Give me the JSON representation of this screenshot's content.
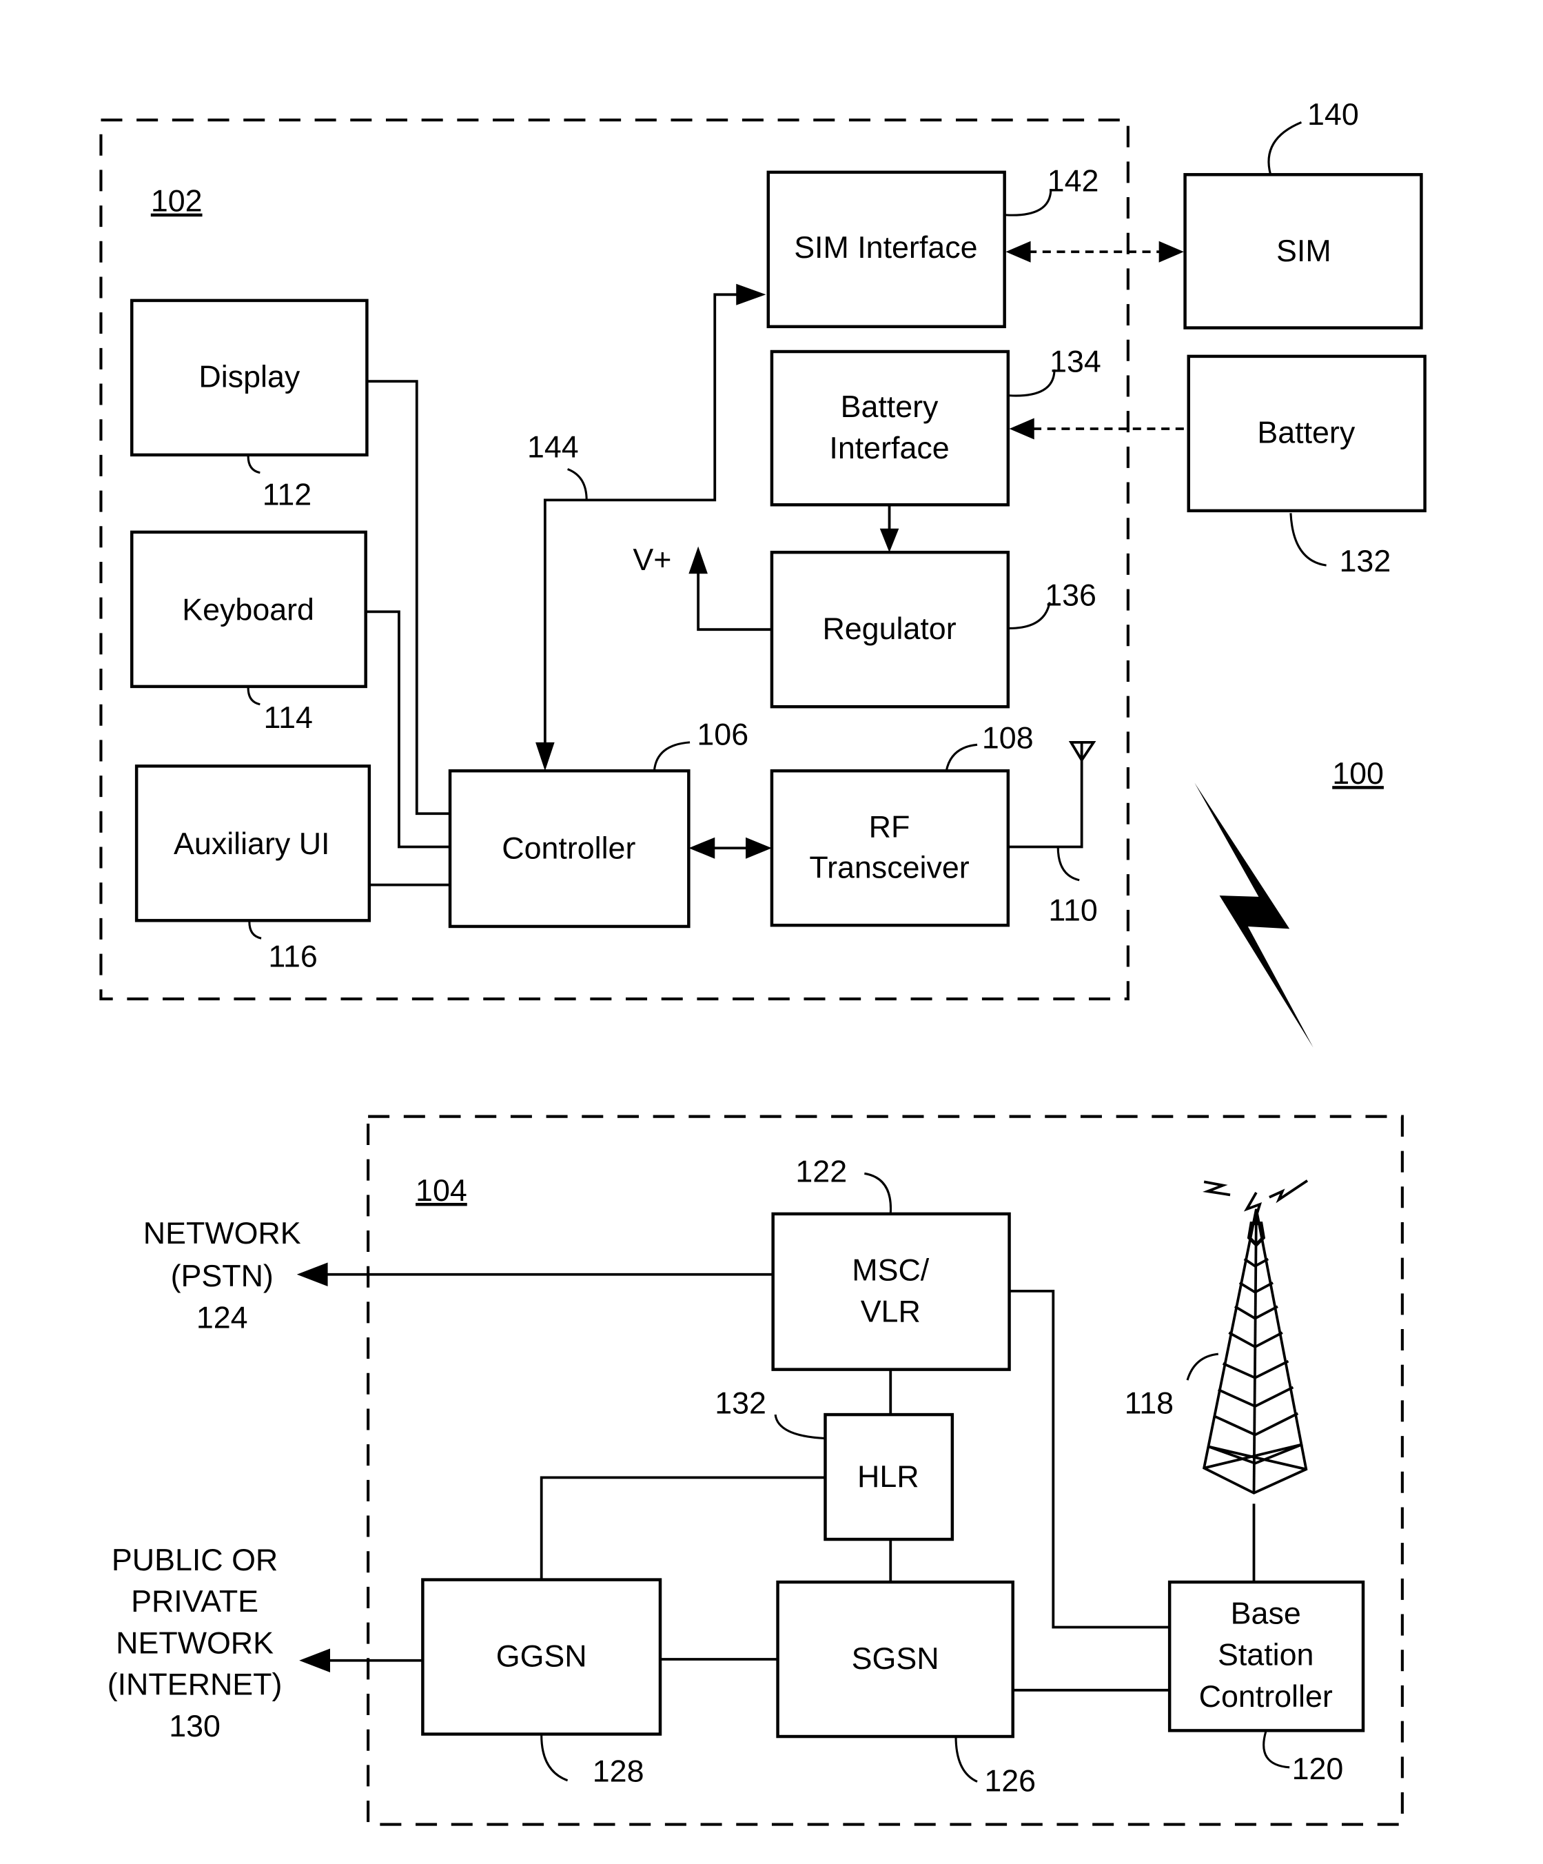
{
  "figure": {
    "system_ref": "100",
    "mobile_device": {
      "ref": "102",
      "blocks": {
        "display": {
          "label": "Display",
          "ref": "112"
        },
        "keyboard": {
          "label": "Keyboard",
          "ref": "114"
        },
        "auxiliary_ui": {
          "label": "Auxiliary UI",
          "ref": "116"
        },
        "controller": {
          "label": "Controller",
          "ref": "106"
        },
        "rf_transceiver": {
          "label_line1": "RF",
          "label_line2": "Transceiver",
          "ref": "108"
        },
        "antenna": {
          "ref": "110"
        },
        "sim_interface": {
          "label": "SIM Interface",
          "ref": "142"
        },
        "battery_interface": {
          "label_line1": "Battery",
          "label_line2": "Interface",
          "ref": "134"
        },
        "regulator": {
          "label": "Regulator",
          "ref": "136"
        },
        "bus": {
          "ref": "144"
        },
        "vplus": {
          "label": "V+"
        }
      }
    },
    "external": {
      "sim": {
        "label": "SIM",
        "ref": "140"
      },
      "battery": {
        "label": "Battery",
        "ref": "132"
      }
    },
    "network": {
      "ref": "104",
      "blocks": {
        "msc_vlr": {
          "label_line1": "MSC/",
          "label_line2": "VLR",
          "ref": "122"
        },
        "hlr": {
          "label": "HLR",
          "ref": "132"
        },
        "ggsn": {
          "label": "GGSN",
          "ref": "128"
        },
        "sgsn": {
          "label": "SGSN",
          "ref": "126"
        },
        "bsc": {
          "label_line1": "Base",
          "label_line2": "Station",
          "label_line3": "Controller",
          "ref": "120"
        },
        "tower": {
          "ref": "118"
        }
      },
      "pstn": {
        "line1": "NETWORK",
        "line2": "(PSTN)",
        "ref": "124"
      },
      "internet": {
        "line1": "PUBLIC OR",
        "line2": "PRIVATE",
        "line3": "NETWORK",
        "line4": "(INTERNET)",
        "ref": "130"
      }
    }
  }
}
